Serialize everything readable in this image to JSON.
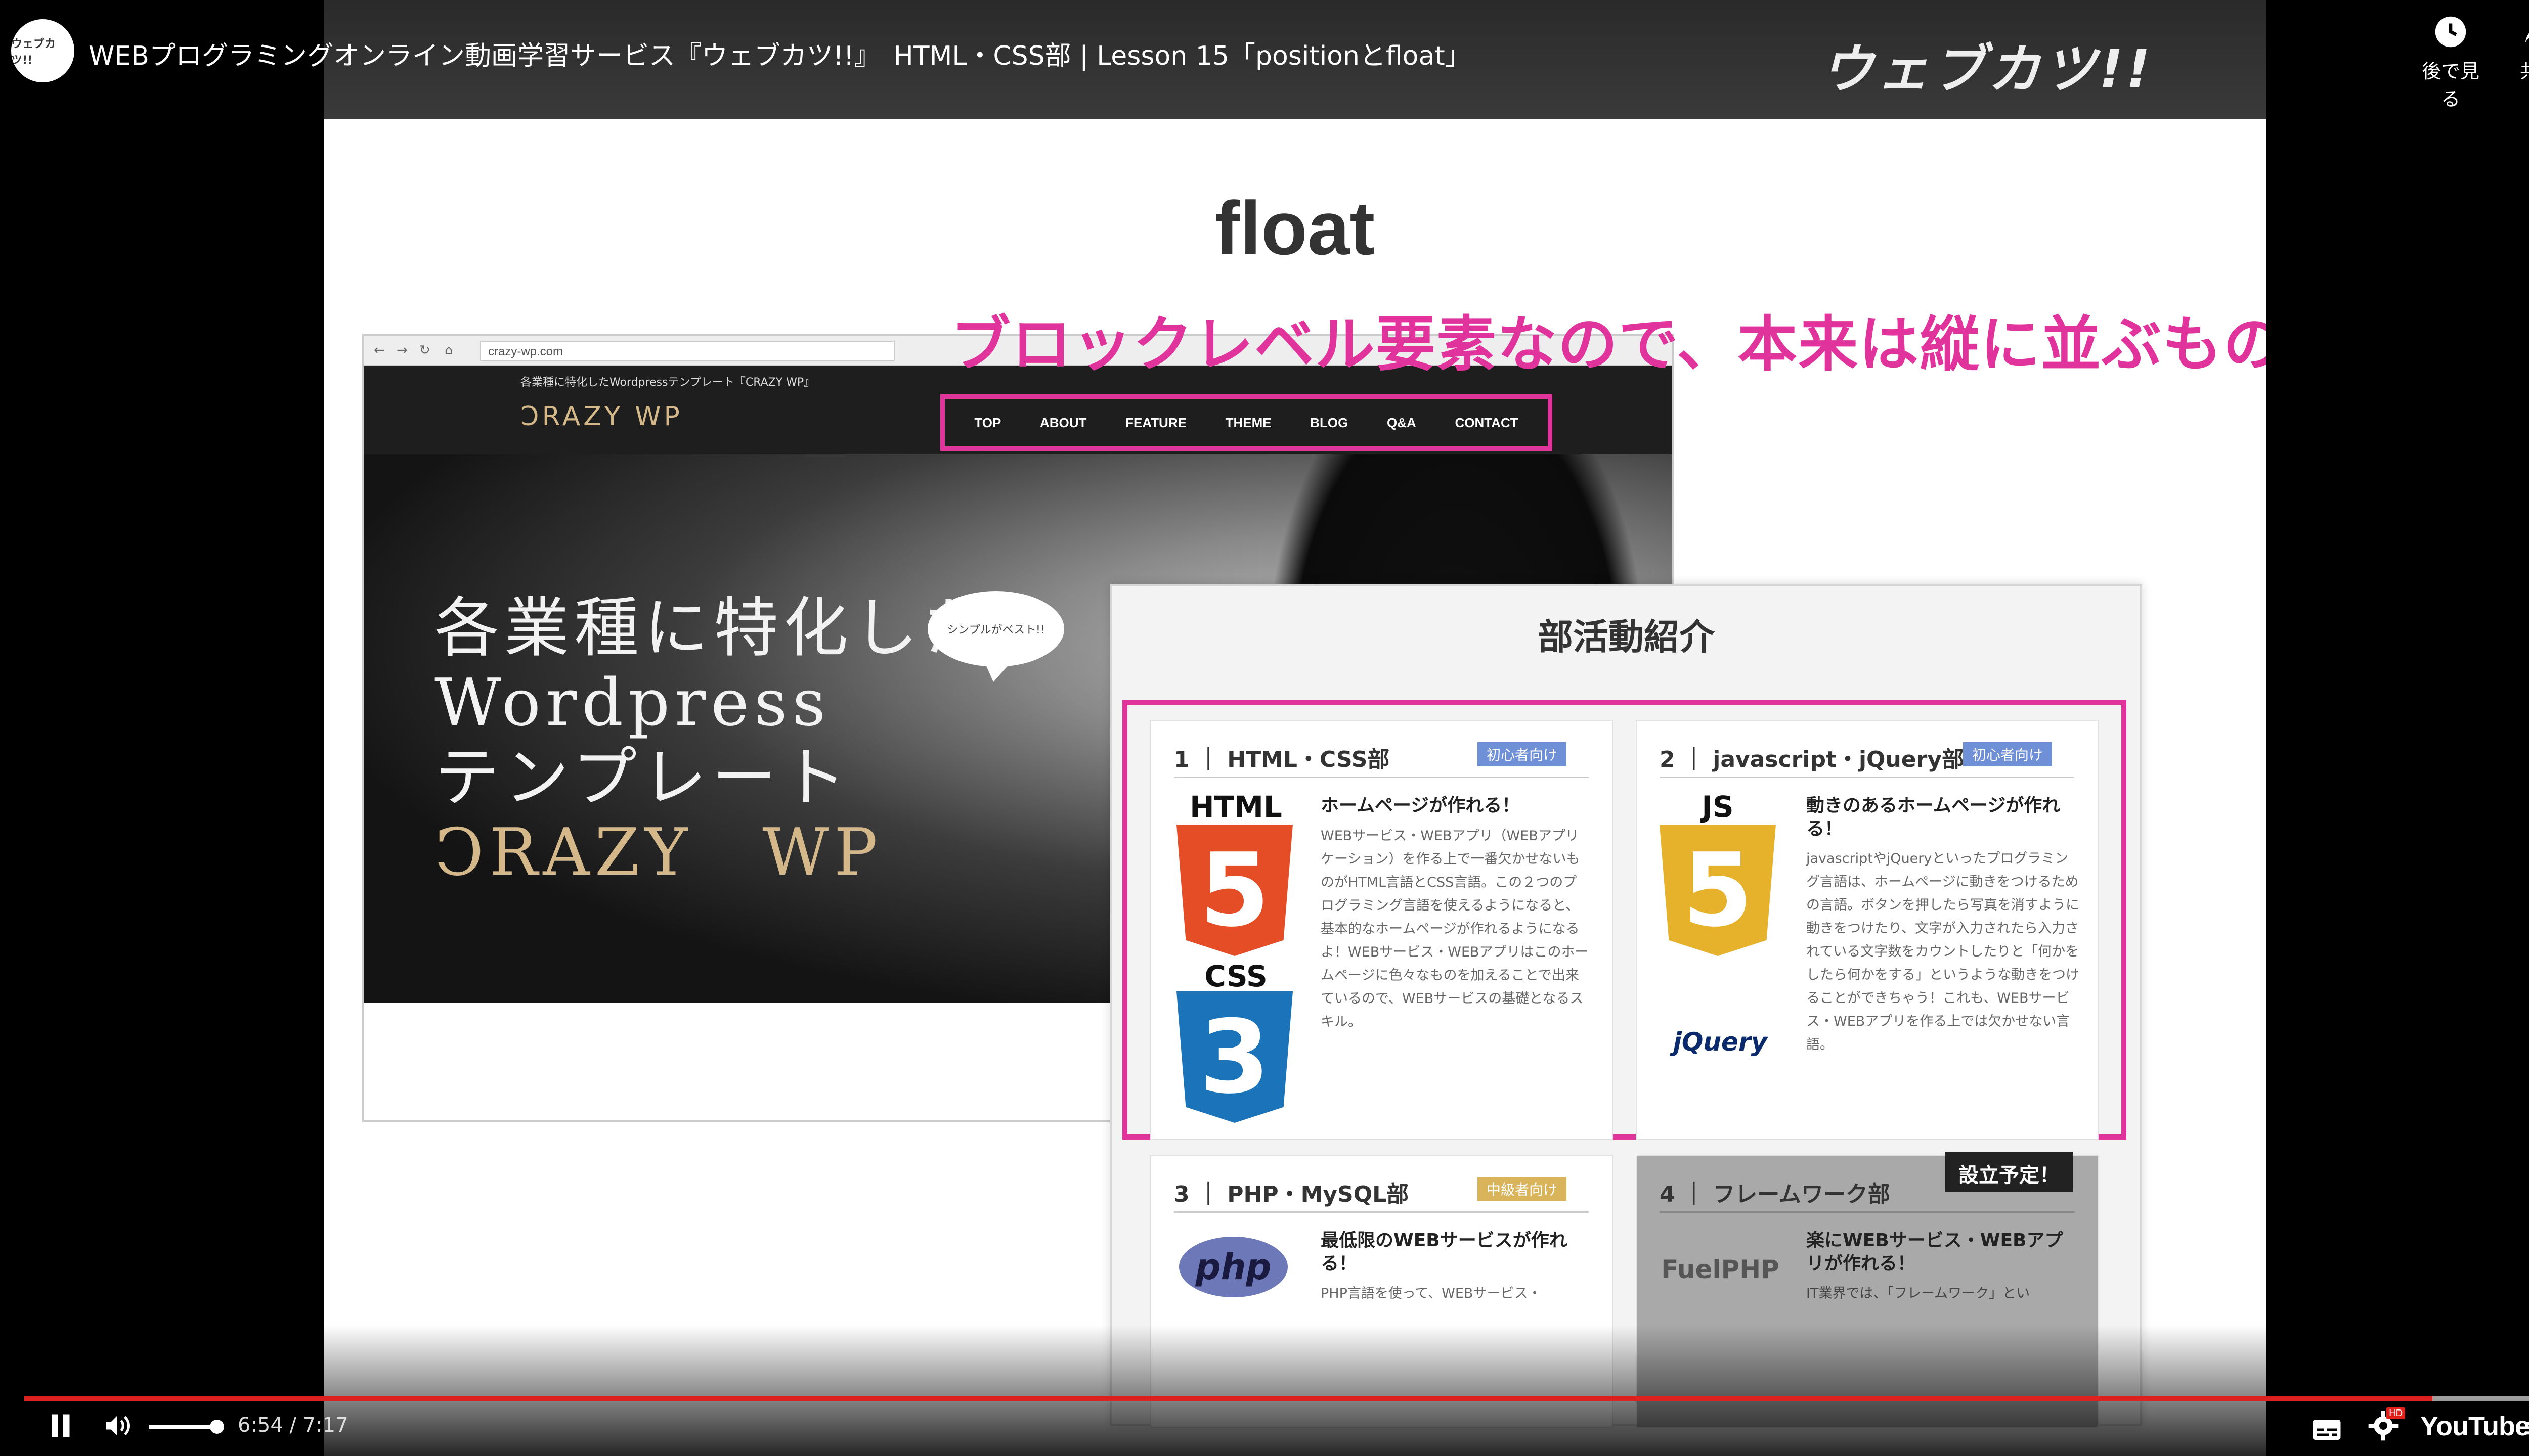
{
  "top_bar": {
    "channel_avatar_text": "ウェブカツ!!",
    "video_title": "WEBプログラミングオンライン動画学習サービス『ウェブカツ!!』　HTML・CSS部 | Lesson 15「positionとfloat」",
    "brand_logo": "ウェブカツ!!",
    "watch_later_label": "後で見る",
    "share_label": "共有"
  },
  "slide": {
    "title": "float",
    "annotation": "ブロックレベル要素なので、本来は縦に並ぶもの",
    "browser": {
      "url": "crazy-wp.com",
      "tagline": "各業種に特化したWordpressテンプレート『CRAZY WP』",
      "logo": "ↃRAZY WP",
      "nav": [
        "TOP",
        "ABOUT",
        "FEATURE",
        "THEME",
        "BLOG",
        "Q&A",
        "CONTACT"
      ],
      "hero_lines": [
        "各業種に特化した",
        "Wordpress",
        "テンプレート"
      ],
      "hero_brand": "ↃRAZY　WP",
      "bubble": "シンプルがベスト!!"
    },
    "club": {
      "title": "部活動紹介",
      "cards": [
        {
          "num": "1 ｜ HTML・CSS部",
          "badge": "初心者向け",
          "heading": "ホームページが作れる！",
          "body": "WEBサービス・WEBアプリ（WEBアプリケーション）を作る上で一番欠かせないものがHTML言語とCSS言語。この２つのプログラミング言語を使えるようになると、基本的なホームページが作れるようになるよ！WEBサービス・WEBアプリはこのホームページに色々なものを加えることで出来ているので、WEBサービスの基礎となるスキル。",
          "logo1": "HTML",
          "logo1_num": "5",
          "logo2": "CSS",
          "logo2_num": "3"
        },
        {
          "num": "2 ｜ javascript・jQuery部",
          "badge": "初心者向け",
          "heading": "動きのあるホームページが作れる！",
          "body": "javascriptやjQueryといったプログラミング言語は、ホームページに動きをつけるための言語。ボタンを押したら写真を消すように動きをつけたり、文字が入力されたら入力されている文字数をカウントしたりと「何かをしたら何かをする」というような動きをつけることができちゃう！これも、WEBサービス・WEBアプリを作る上では欠かせない言語。",
          "logo1": "JS",
          "logo1_num": "5",
          "logo2": "jQuery"
        },
        {
          "num": "3 ｜ PHP・MySQL部",
          "badge": "中級者向け",
          "heading": "最低限のWEBサービスが作れる！",
          "body": "PHP言語を使って、WEBサービス・",
          "logo1": "php"
        },
        {
          "num": "4 ｜ フレームワーク部",
          "badge": "設立予定！",
          "heading": "楽にWEBサービス・WEBアプリが作れる！",
          "body": "IT業界では、「フレームワーク」とい",
          "logo1": "FuelPHP"
        }
      ]
    }
  },
  "player": {
    "time_display": "6:54 / 7:17",
    "progress_fraction": 0.9474,
    "volume_fraction": 0.85,
    "youtube_label": "YouTube",
    "hd_badge": "HD"
  },
  "colors": {
    "accent_pink": "#e0339c",
    "progress_red": "#e0201b",
    "badge_blue": "#6f8fd6",
    "badge_gold": "#d9b45a",
    "gold_text": "#d4b88a"
  }
}
